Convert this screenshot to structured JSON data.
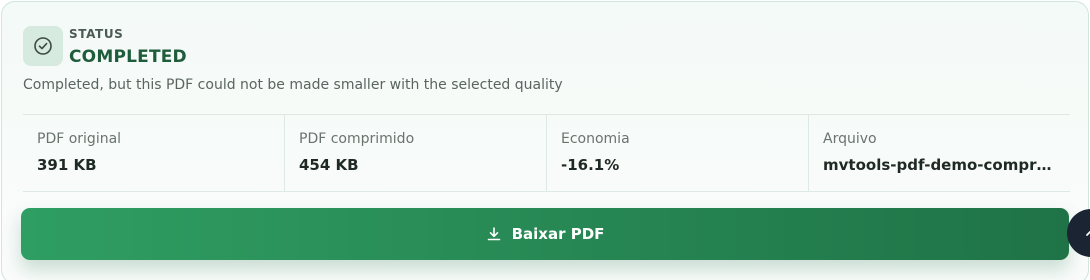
{
  "status": {
    "kicker": "STATUS",
    "title": "COMPLETED",
    "message": "Completed, but this PDF could not be made smaller with the selected quality",
    "icon": "check-circle-icon",
    "accent": "#1f5c3b"
  },
  "stats": [
    {
      "label": "PDF original",
      "value": "391 KB"
    },
    {
      "label": "PDF comprimido",
      "value": "454 KB"
    },
    {
      "label": "Economia",
      "value": "-16.1%"
    },
    {
      "label": "Arquivo",
      "value": "mvtools-pdf-demo-compr…"
    }
  ],
  "download": {
    "label": "Baixar PDF",
    "icon": "download-icon",
    "color_start": "#2f9e62",
    "color_end": "#1f7347"
  },
  "scroll_top": {
    "icon": "chevron-up-icon",
    "color": "#1b2433"
  }
}
